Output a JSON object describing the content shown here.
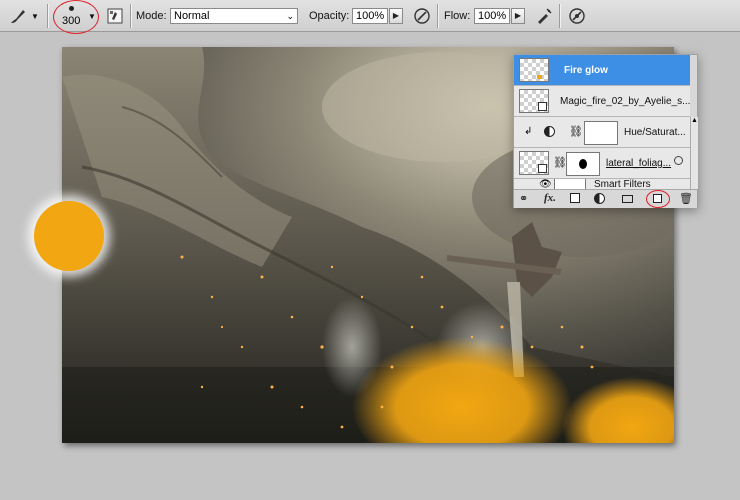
{
  "toolbar": {
    "brush_size": "300",
    "mode_label": "Mode:",
    "mode_value": "Normal",
    "opacity_label": "Opacity:",
    "opacity_value": "100%",
    "flow_label": "Flow:",
    "flow_value": "100%"
  },
  "layers": [
    {
      "name": "Fire glow",
      "selected": true
    },
    {
      "name": "Magic_fire_02_by_Ayelie_s...",
      "selected": false
    },
    {
      "name": "Hue/Saturat...",
      "selected": false
    },
    {
      "name": "lateral_foliag...",
      "selected": false
    }
  ],
  "smart_filters_label": "Smart Filters",
  "layer_bottom_icons": [
    "link-icon",
    "fx-icon",
    "mask-icon",
    "adjustment-icon",
    "group-folder-icon",
    "new-layer-icon",
    "trash-icon"
  ],
  "fx_label": "fx.",
  "colors": {
    "brush": "#f2a612",
    "highlight_circle": "#e0202a",
    "selected_layer": "#3d8fe6"
  }
}
